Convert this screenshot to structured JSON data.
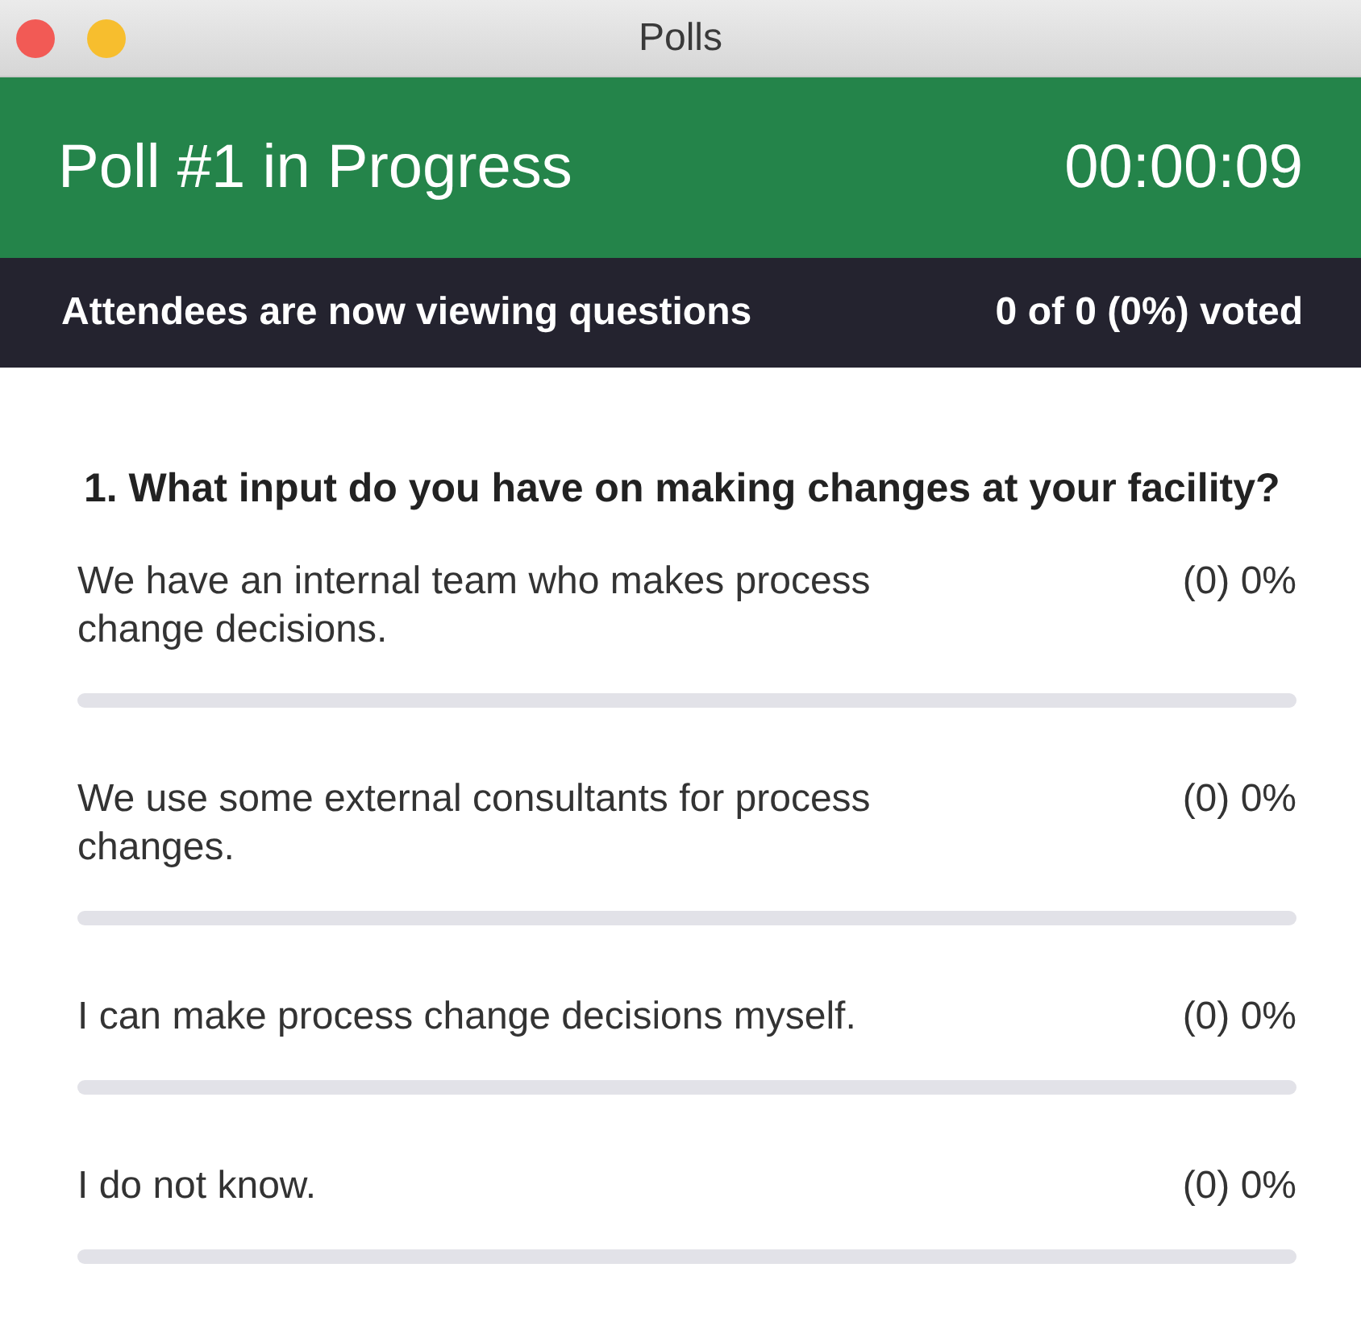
{
  "window": {
    "title": "Polls"
  },
  "header": {
    "title": "Poll #1 in Progress",
    "timer": "00:00:09"
  },
  "status": {
    "message": "Attendees are now viewing questions",
    "votes": "0 of 0 (0%) voted"
  },
  "question": {
    "text": "1. What input do you have on making changes at your facility?",
    "options": [
      {
        "label": "We have an internal team who makes process change decisions.",
        "result": "(0) 0%",
        "level": 0
      },
      {
        "label": "We use some external consultants for process changes.",
        "result": "(0) 0%",
        "level": 0
      },
      {
        "label": "I can make process change decisions myself.",
        "result": "(0) 0%",
        "level": 0
      },
      {
        "label": "I do not know.",
        "result": "(0) 0%",
        "level": 0
      }
    ]
  }
}
